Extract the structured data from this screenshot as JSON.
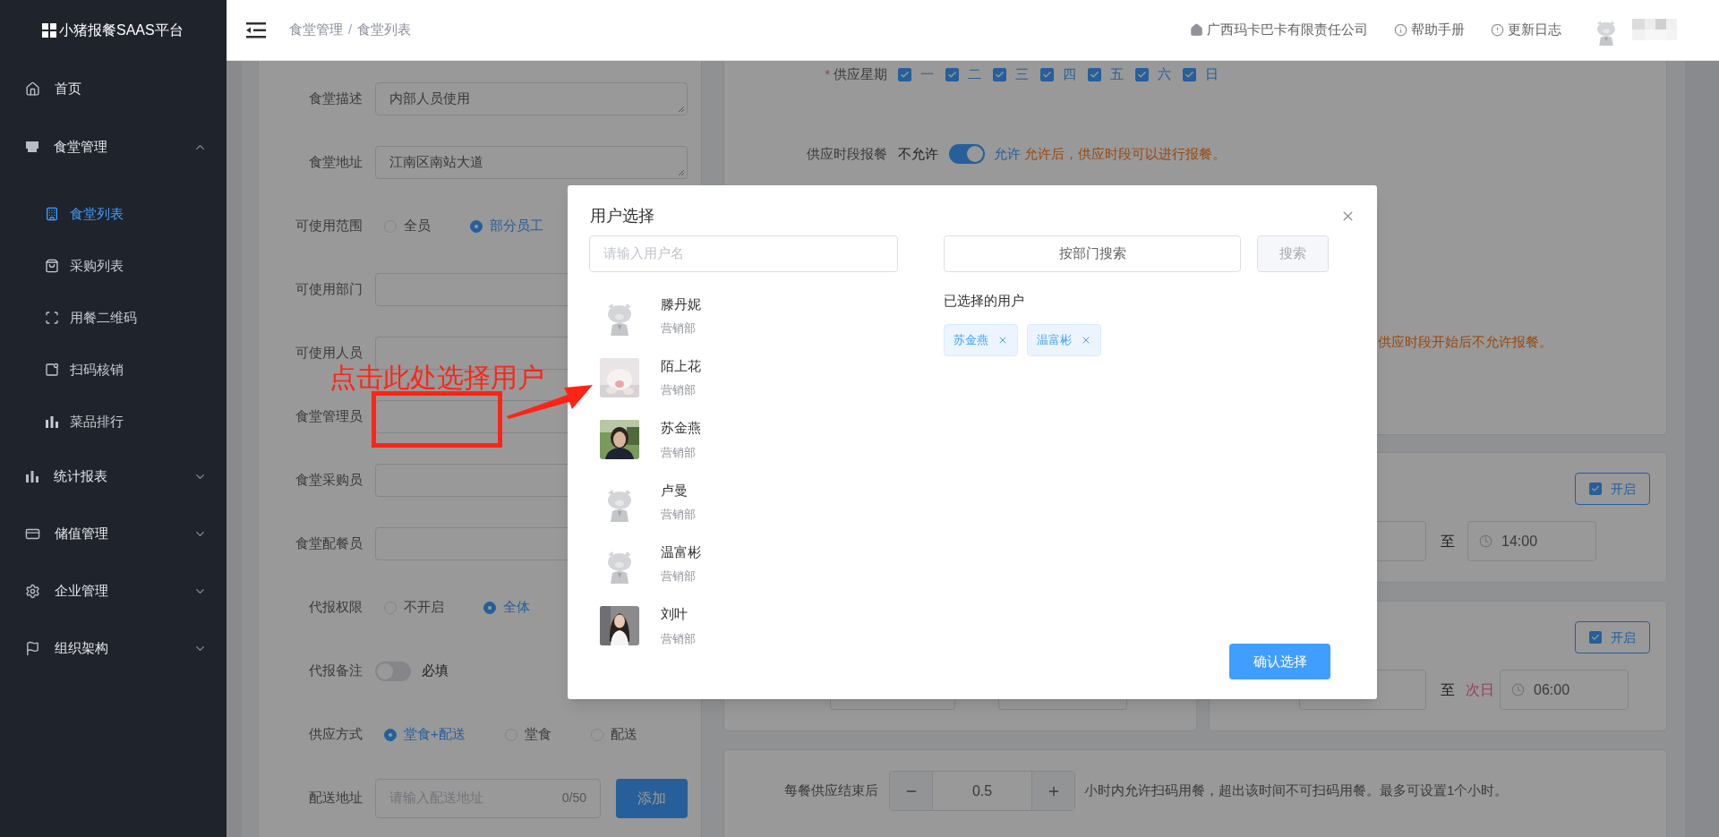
{
  "sidebar": {
    "logo_text": "小猪报餐SAAS平台",
    "items": [
      {
        "label": "首页",
        "kind": "link"
      },
      {
        "label": "食堂管理",
        "kind": "group",
        "expanded": true,
        "children": [
          {
            "label": "食堂列表",
            "selected": true
          },
          {
            "label": "采购列表",
            "selected": false
          },
          {
            "label": "用餐二维码",
            "selected": false
          },
          {
            "label": "扫码核销",
            "selected": false
          },
          {
            "label": "菜品排行",
            "selected": false
          }
        ]
      },
      {
        "label": "统计报表",
        "kind": "group",
        "expanded": false
      },
      {
        "label": "储值管理",
        "kind": "group",
        "expanded": false
      },
      {
        "label": "企业管理",
        "kind": "group",
        "expanded": false
      },
      {
        "label": "组织架构",
        "kind": "group",
        "expanded": false
      }
    ]
  },
  "header": {
    "breadcrumb": [
      "食堂管理",
      "食堂列表"
    ],
    "separator": "/",
    "links": [
      {
        "label": "广西玛卡巴卡有限责任公司"
      },
      {
        "label": "帮助手册"
      },
      {
        "label": "更新日志"
      }
    ]
  },
  "left_form": {
    "rows": [
      {
        "label": "食堂描述",
        "kind": "textarea",
        "value": "内部人员使用"
      },
      {
        "label": "食堂地址",
        "kind": "textarea",
        "value": "江南区南站大道"
      },
      {
        "label": "可使用范围",
        "kind": "radio",
        "options": [
          {
            "label": "全员",
            "selected": false
          },
          {
            "label": "部分员工",
            "selected": true
          }
        ]
      },
      {
        "label": "可使用部门",
        "kind": "input"
      },
      {
        "label": "可使用人员",
        "kind": "input"
      },
      {
        "label": "食堂管理员",
        "kind": "input"
      },
      {
        "label": "食堂采购员",
        "kind": "input"
      },
      {
        "label": "食堂配餐员",
        "kind": "input"
      },
      {
        "label": "代报权限",
        "kind": "radio",
        "options": [
          {
            "label": "不开启",
            "selected": false
          },
          {
            "label": "全体",
            "selected": true
          }
        ]
      },
      {
        "label": "代报备注",
        "kind": "switch",
        "on": false,
        "text": "必填"
      },
      {
        "label": "供应方式",
        "kind": "radio",
        "options": [
          {
            "label": "堂食+配送",
            "selected": true
          },
          {
            "label": "堂食",
            "selected": false
          },
          {
            "label": "配送",
            "selected": false
          }
        ]
      },
      {
        "label": "配送地址",
        "kind": "address",
        "placeholder": "请输入配送地址",
        "counter": "0/50",
        "button": "添加"
      }
    ]
  },
  "right_form": {
    "weekdays": {
      "required_mark": "*",
      "label": "供应星期",
      "days": [
        {
          "label": "一",
          "checked": true
        },
        {
          "label": "二",
          "checked": true
        },
        {
          "label": "三",
          "checked": true
        },
        {
          "label": "四",
          "checked": true
        },
        {
          "label": "五",
          "checked": true
        },
        {
          "label": "六",
          "checked": true
        },
        {
          "label": "日",
          "checked": true
        }
      ]
    },
    "period_booking": {
      "label": "供应时段报餐",
      "off_label": "不允许",
      "on": true,
      "on_label": "允许",
      "hint": "允许后，供应时段可以进行报餐。"
    },
    "late_hint": "供应时段开始后不允许报餐。",
    "time_cards": [
      {
        "toggle": {
          "label": "开启",
          "checked": true
        },
        "to": "至",
        "end_time": "14:00"
      },
      {
        "toggle": {
          "label": "开启",
          "checked": true
        },
        "to": "至",
        "next_day": "次日",
        "end_time": "06:00"
      }
    ],
    "scan_window": {
      "label": "每餐供应结束后",
      "value": "0.5",
      "hint": "小时内允许扫码用餐，超出该时间不可扫码用餐。最多可设置1个小时。"
    }
  },
  "modal": {
    "title": "用户选择",
    "search": {
      "placeholder": "请输入用户名"
    },
    "dept_button": "按部门搜索",
    "search_button": {
      "label": "搜索",
      "disabled": true
    },
    "users": [
      {
        "name": "滕丹妮",
        "dept": "营销部",
        "kind": "default-avatar"
      },
      {
        "name": "陌上花",
        "dept": "营销部",
        "kind": "picture"
      },
      {
        "name": "苏金燕",
        "dept": "营销部",
        "kind": "picture"
      },
      {
        "name": "卢曼",
        "dept": "营销部",
        "kind": "default-avatar"
      },
      {
        "name": "温富彬",
        "dept": "营销部",
        "kind": "default-avatar"
      },
      {
        "name": "刘叶",
        "dept": "营销部",
        "kind": "picture"
      }
    ],
    "selected_heading": "已选择的用户",
    "selected_users": [
      {
        "label": "苏金燕"
      },
      {
        "label": "温富彬"
      }
    ],
    "confirm_button": "确认选择"
  },
  "annotation": {
    "text": "点击此处选择用户"
  }
}
